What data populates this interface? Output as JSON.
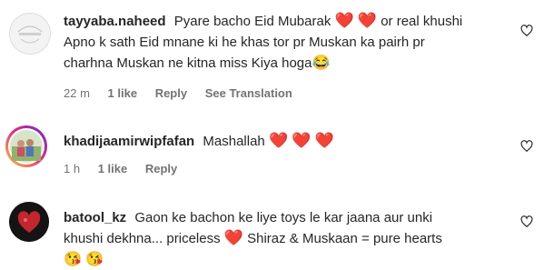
{
  "comments": [
    {
      "username": "tayyaba.naheed",
      "lines": [
        "Pyare bacho Eid Mubarak",
        "or real khushi",
        "Apno k sath Eid mnane ki he khas tor pr Muskan ka pairh pr",
        "charhna Muskan ne kitna miss Kiya hoga"
      ],
      "emojis": [
        "❤️",
        "❤️",
        "😂"
      ],
      "time": "22 m",
      "likes": "1 like",
      "reply": "Reply",
      "translate": "See Translation"
    },
    {
      "username": "khadijaamirwipfafan",
      "lines": [
        "Mashallah"
      ],
      "emojis": [
        "❤️",
        "❤️",
        "❤️"
      ],
      "time": "1 h",
      "likes": "1 like",
      "reply": "Reply"
    },
    {
      "username": "batool_kz",
      "lines": [
        "Gaon ke bachon ke liye toys le kar jaana aur unki",
        "khushi dekhna... priceless",
        "Shiraz & Muskaan = pure hearts"
      ],
      "emojis": [
        "❤️",
        "😘",
        "😘"
      ]
    }
  ],
  "colors": {
    "heart": "#ed1b3b",
    "meta": "#737373",
    "text": "#262626"
  },
  "icons": {
    "like": "heart-outline-icon"
  }
}
